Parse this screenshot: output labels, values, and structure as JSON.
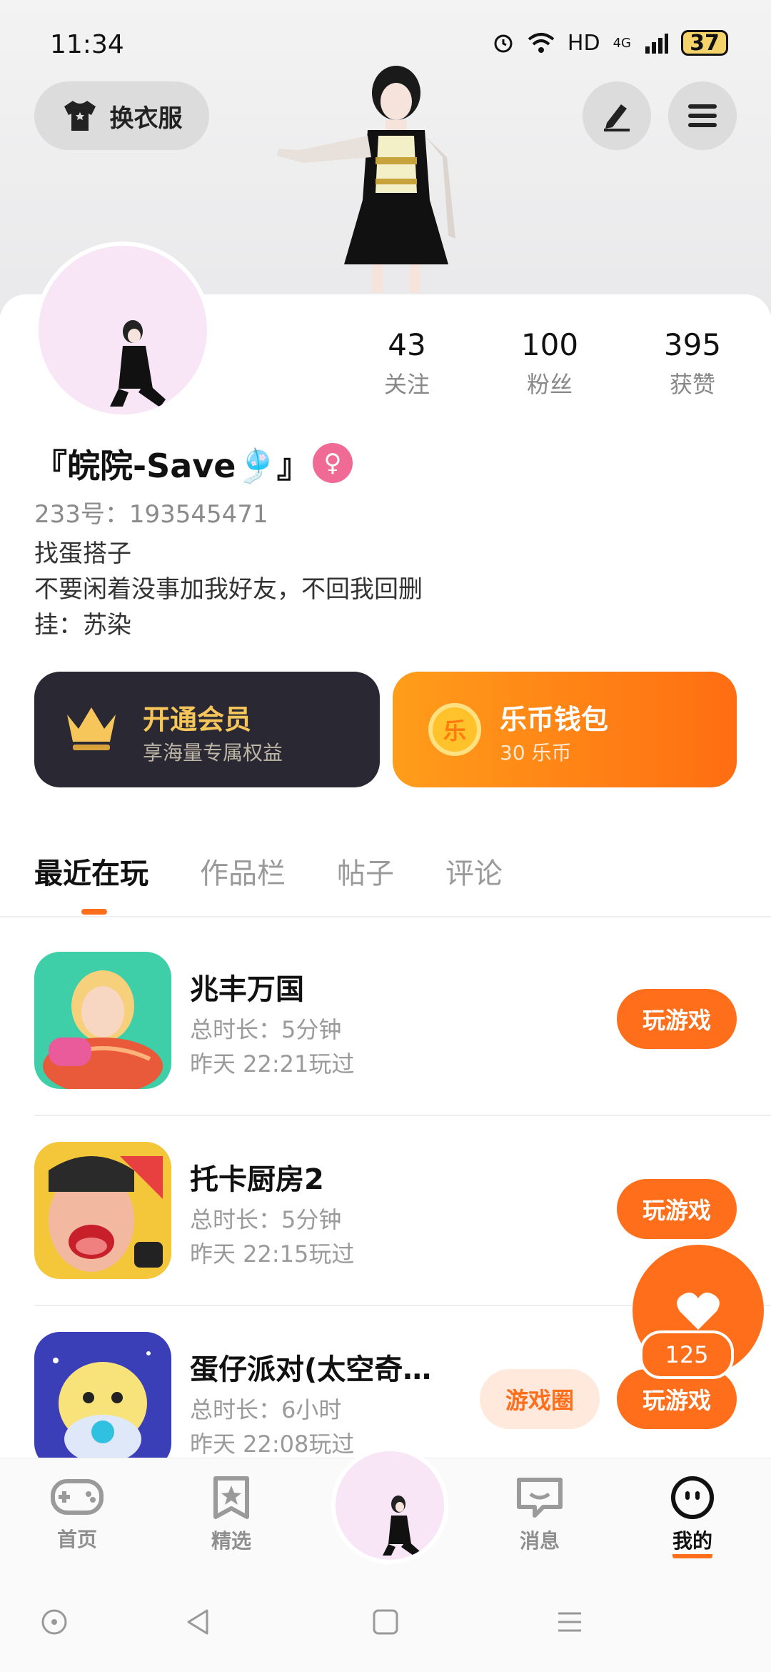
{
  "status": {
    "time": "11:34",
    "network": "HD",
    "signal": "4G",
    "battery": "37"
  },
  "header": {
    "dress_label": "换衣服"
  },
  "stats": [
    {
      "num": "43",
      "label": "关注"
    },
    {
      "num": "100",
      "label": "粉丝"
    },
    {
      "num": "395",
      "label": "获赞"
    }
  ],
  "profile": {
    "username": "『皖院-Save🎐』",
    "gender_symbol": "♀",
    "uid": "233号：193545471",
    "bio_lines": [
      "找蛋搭子",
      "不要闲着没事加我好友，不回我回删",
      "挂：苏染"
    ]
  },
  "vip": {
    "title": "开通会员",
    "subtitle": "享海量专属权益"
  },
  "wallet": {
    "title": "乐币钱包",
    "subtitle": "30 乐币",
    "coin_glyph": "乐"
  },
  "tabs": [
    "最近在玩",
    "作品栏",
    "帖子",
    "评论"
  ],
  "games": [
    {
      "name": "兆丰万国",
      "duration": "总时长：5分钟",
      "last": "昨天 22:21玩过",
      "play": "玩游戏"
    },
    {
      "name": "托卡厨房2",
      "duration": "总时长：5分钟",
      "last": "昨天 22:15玩过",
      "play": "玩游戏"
    },
    {
      "name": "蛋仔派对(太空奇…",
      "duration": "总时长：6小时",
      "last": "昨天 22:08玩过",
      "play": "玩游戏",
      "circle": "游戏圈"
    }
  ],
  "like": {
    "count": "125"
  },
  "nav": [
    {
      "label": "首页"
    },
    {
      "label": "精选"
    },
    {
      "label": "消息"
    },
    {
      "label": "我的"
    }
  ],
  "colors": {
    "accent": "#ff6f1b",
    "vip_bg": "#2a2833",
    "gold": "#f6c65a"
  }
}
